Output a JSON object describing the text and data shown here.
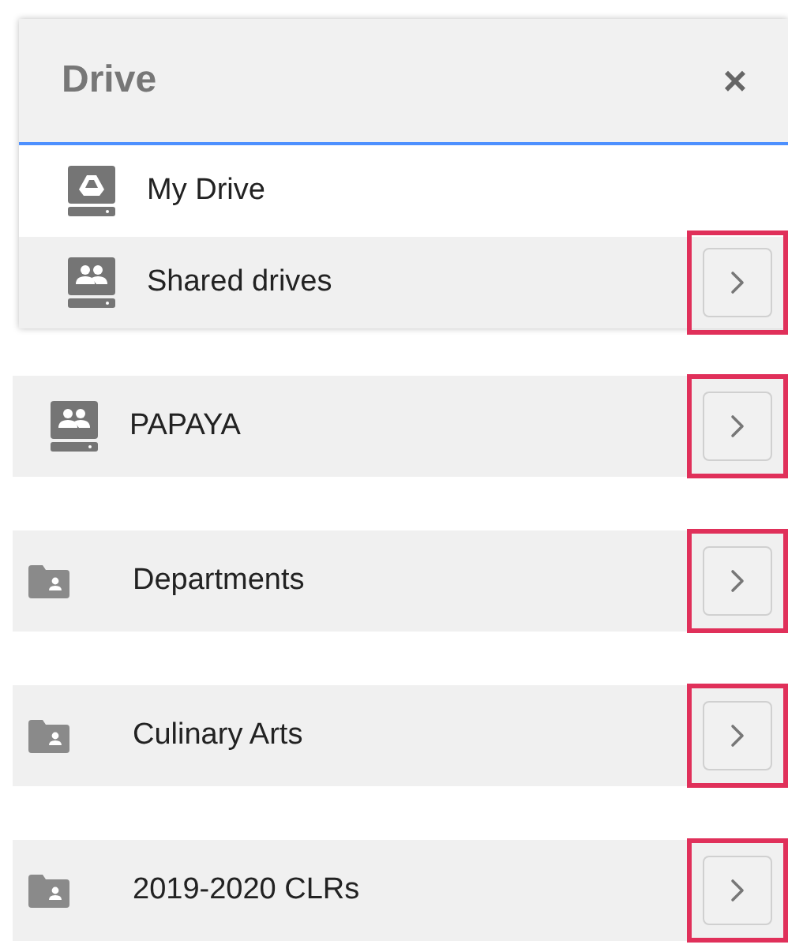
{
  "panel": {
    "title": "Drive",
    "close": "×",
    "items": [
      {
        "label": "My Drive",
        "kind": "drive",
        "expandable": false
      },
      {
        "label": "Shared drives",
        "kind": "shared",
        "expandable": true,
        "highlighted": true
      }
    ]
  },
  "rows": [
    {
      "label": "PAPAYA",
      "kind": "shared",
      "expandable": true,
      "highlighted": true
    },
    {
      "label": "Departments",
      "kind": "folder",
      "expandable": true,
      "highlighted": true
    },
    {
      "label": "Culinary Arts",
      "kind": "folder",
      "expandable": true,
      "highlighted": true
    },
    {
      "label": "2019-2020 CLRs",
      "kind": "folder",
      "expandable": true,
      "highlighted": true
    }
  ]
}
